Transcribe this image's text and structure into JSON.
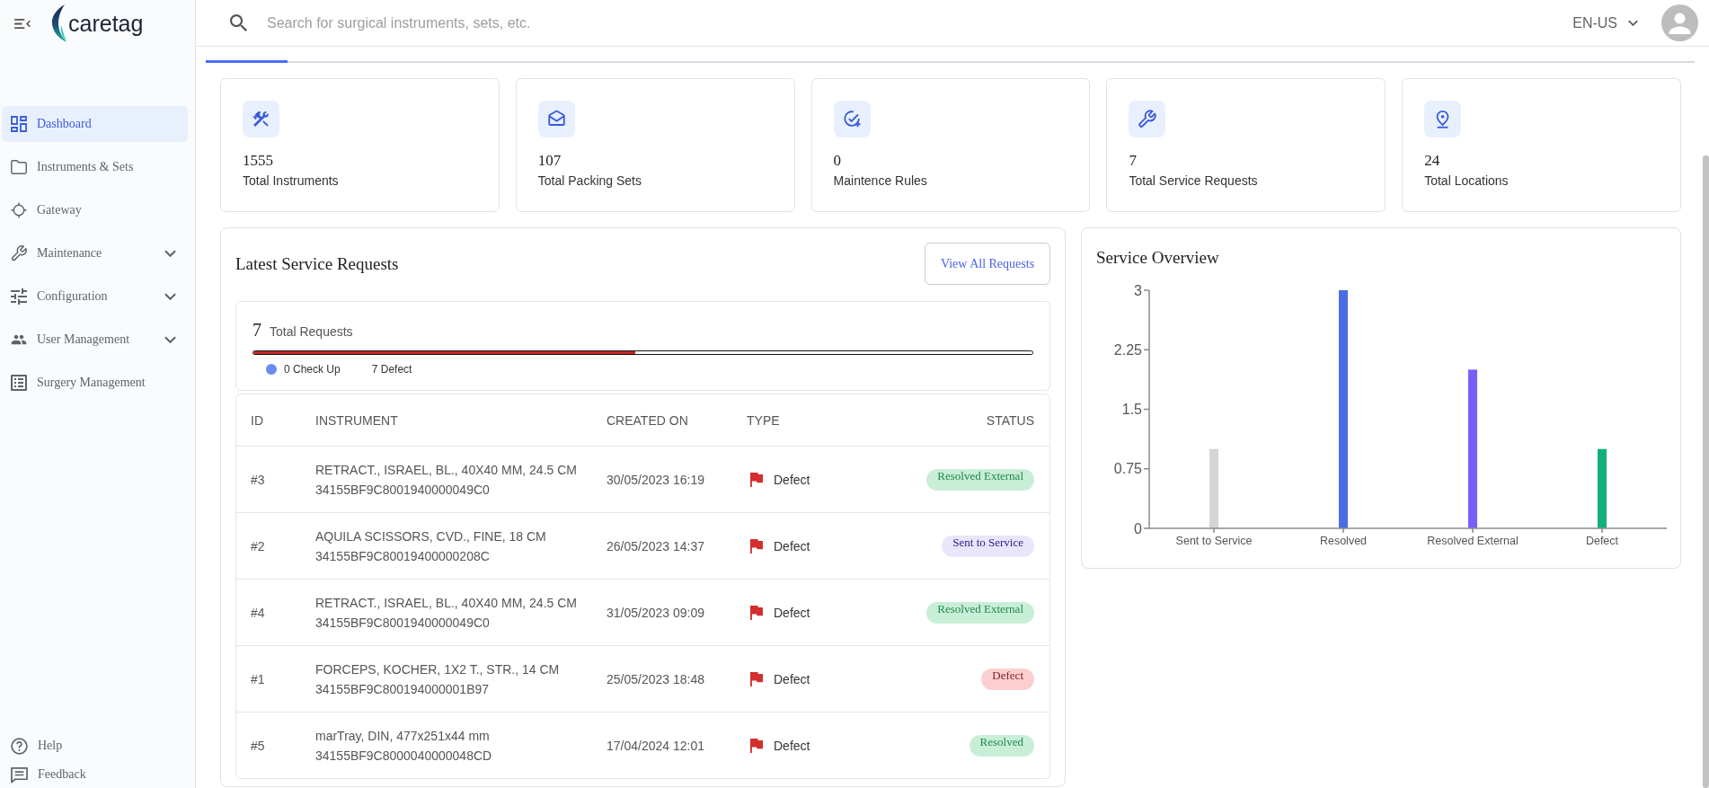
{
  "sidebar": {
    "brand": "caretag",
    "items": [
      {
        "label": "Dashboard",
        "selected": true
      },
      {
        "label": "Instruments & Sets",
        "selected": false
      },
      {
        "label": "Gateway",
        "selected": false
      },
      {
        "label": "Maintenance",
        "selected": false,
        "expanded": false
      },
      {
        "label": "Configuration",
        "selected": false,
        "expanded": false
      },
      {
        "label": "User Management",
        "selected": false,
        "expanded": false
      },
      {
        "label": "Surgery Management",
        "selected": false
      }
    ],
    "footer_items": [
      {
        "label": "Help"
      },
      {
        "label": "Feedback"
      }
    ]
  },
  "topbar": {
    "search": {
      "placeholder": "Search for surgical instruments, sets, etc."
    },
    "language": "EN-US"
  },
  "stats": [
    {
      "value": "1555",
      "label": "Total Instruments"
    },
    {
      "value": "107",
      "label": "Total Packing Sets"
    },
    {
      "value": "0",
      "label": "Maintence Rules"
    },
    {
      "value": "7",
      "label": "Total Service Requests"
    },
    {
      "value": "24",
      "label": "Total Locations"
    }
  ],
  "service_requests": {
    "title": "Latest Service Requests",
    "view_all_button": "View All Requests",
    "summary": {
      "total": "7",
      "total_label": "Total Requests",
      "level": 0.49,
      "legend": [
        {
          "label": "0 Check Up",
          "color": "#6b8cef"
        },
        {
          "label": "7 Defect"
        }
      ]
    },
    "table": {
      "columns": [
        "ID",
        "INSTRUMENT",
        "CREATED ON",
        "TYPE",
        "STATUS"
      ],
      "rows": [
        {
          "id": "#3",
          "instrument": "RETRACT., ISRAEL, BL., 40X40 MM, 24.5 CM",
          "code": "34155BF9C8001940000049C0",
          "created_on": "30/05/2023 16:19",
          "type": "Defect",
          "status": {
            "label": "Resolved External",
            "color": "#c9eed8"
          }
        },
        {
          "id": "#2",
          "instrument": "AQUILA SCISSORS, CVD., FINE, 18 CM",
          "code": "34155BF9C80019400000208C",
          "created_on": "26/05/2023 14:37",
          "type": "Defect",
          "status": {
            "label": "Sent to Service",
            "color": "#e9e5fb"
          }
        },
        {
          "id": "#4",
          "instrument": "RETRACT., ISRAEL, BL., 40X40 MM, 24.5 CM",
          "code": "34155BF9C8001940000049C0",
          "created_on": "31/05/2023 09:09",
          "type": "Defect",
          "status": {
            "label": "Resolved External",
            "color": "#c9eed8"
          }
        },
        {
          "id": "#1",
          "instrument": "FORCEPS, KOCHER, 1X2 T., STR., 14 CM",
          "code": "34155BF9C800194000001B97",
          "created_on": "25/05/2023 18:48",
          "type": "Defect",
          "status": {
            "label": "Defect",
            "color": "#fbcfd0"
          }
        },
        {
          "id": "#5",
          "instrument": "marTray, DIN, 477x251x44 mm",
          "code": "34155BF9C8000040000048CD",
          "created_on": "17/04/2024 12:01",
          "type": "Defect",
          "status": {
            "label": "Resolved",
            "color": "#c9eed8"
          }
        }
      ]
    }
  },
  "service_overview": {
    "chart_data": {
      "type": "bar",
      "title": "Service Overview",
      "categories": [
        "Sent to Service",
        "Resolved",
        "Resolved External",
        "Defect"
      ],
      "values": [
        1,
        3,
        2,
        1
      ],
      "colors": [
        "#d4d5d9",
        "#4a6de5",
        "#7b5ef7",
        "#13b07d"
      ],
      "ylim": [
        0,
        3
      ],
      "yticks": [
        0,
        0.75,
        1.5,
        2.25,
        3
      ]
    }
  }
}
